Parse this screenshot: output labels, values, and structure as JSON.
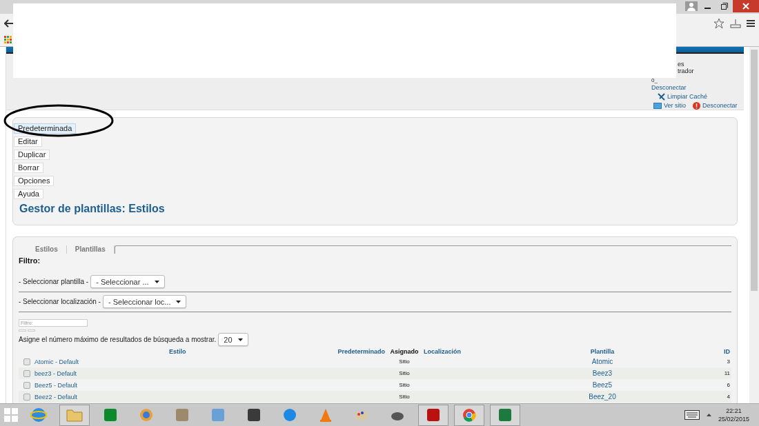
{
  "header": {
    "user_lines": [
      "es",
      "trador",
      "0_"
    ],
    "links": [
      {
        "kind": "plain",
        "label": "Desconectar"
      },
      {
        "kind": "cache",
        "label": "Limpiar Caché"
      }
    ],
    "bottom_links": [
      {
        "kind": "site",
        "label": "Ver sitio"
      },
      {
        "kind": "logout",
        "label": "Desconectar"
      }
    ]
  },
  "toolbar": [
    {
      "label": "Predeterminada",
      "selected": true
    },
    {
      "label": "Editar",
      "selected": false
    },
    {
      "label": "Duplicar",
      "selected": false
    },
    {
      "label": "Borrar",
      "selected": false
    },
    {
      "label": "Opciones",
      "selected": false
    },
    {
      "label": "Ayuda",
      "selected": false
    }
  ],
  "page_title": "Gestor de plantillas: Estilos",
  "tabs": [
    {
      "label": "Estilos",
      "selected": false
    },
    {
      "label": "Plantillas",
      "selected": false
    }
  ],
  "filter": {
    "heading": "Filtro:",
    "selects": [
      {
        "label": "- Seleccionar plantilla -",
        "value": "- Seleccionar ..."
      },
      {
        "label": "- Seleccionar localización -",
        "value": "- Seleccionar loc..."
      }
    ],
    "search": {
      "placeholder": "Filtro:"
    },
    "limit": {
      "label": "Asigne el número máximo de resultados de búsqueda a mostrar.",
      "value": "20"
    }
  },
  "table": {
    "columns": [
      {
        "label": "Estilo",
        "kind": "link"
      },
      {
        "label": "Predeterminado",
        "kind": "link"
      },
      {
        "label": "Asignado",
        "kind": "plain"
      },
      {
        "label": "Localización",
        "kind": "link"
      },
      {
        "label": "Plantilla",
        "kind": "link"
      },
      {
        "label": "ID",
        "kind": "link"
      }
    ],
    "rows": [
      {
        "checked": false,
        "style": "Atomic - Default",
        "assigned": "Sitio",
        "template": "Atomic",
        "id": "3"
      },
      {
        "checked": false,
        "style": "beez3 - Default",
        "assigned": "Sitio",
        "template": "Beez3",
        "id": "11"
      },
      {
        "checked": false,
        "style": "Beez5 - Default",
        "assigned": "Sitio",
        "template": "Beez5",
        "id": "6"
      },
      {
        "checked": false,
        "style": "Beez2 - Default",
        "assigned": "Sitio",
        "template": "Beez_20",
        "id": "4"
      }
    ]
  },
  "taskbar": {
    "time": "22:21",
    "date": "25/02/2015"
  }
}
